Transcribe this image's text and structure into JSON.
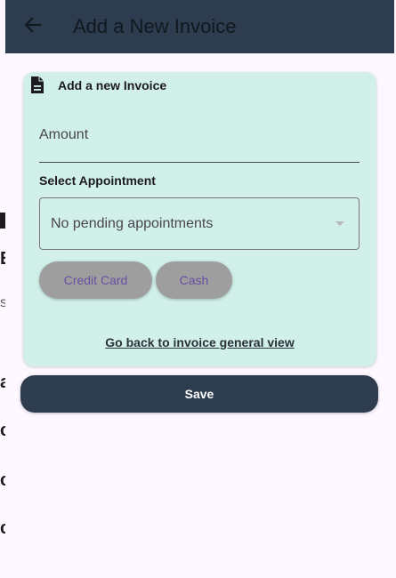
{
  "background_page": {
    "fragments": [
      "E",
      "s",
      "a",
      "c",
      "c",
      "c"
    ]
  },
  "app_bar": {
    "title": "Add a New Invoice",
    "back_icon": "arrow-left-icon",
    "background": "#2d3c4e"
  },
  "card": {
    "icon": "document-icon",
    "title": "Add a new Invoice",
    "background": "#d0f0e9",
    "amount": {
      "placeholder": "Amount",
      "value": ""
    },
    "appointment": {
      "label": "Select Appointment",
      "selected": "No pending appointments"
    },
    "payment_methods": [
      "Credit Card",
      "Cash"
    ],
    "back_link": "Go back to invoice general view"
  },
  "save_button": {
    "label": "Save"
  },
  "colors": {
    "primary_dark": "#2d3c4e",
    "card_mint": "#d0f0e9",
    "accent_purple": "#6750a4",
    "page_bg": "#fdf7ff"
  }
}
